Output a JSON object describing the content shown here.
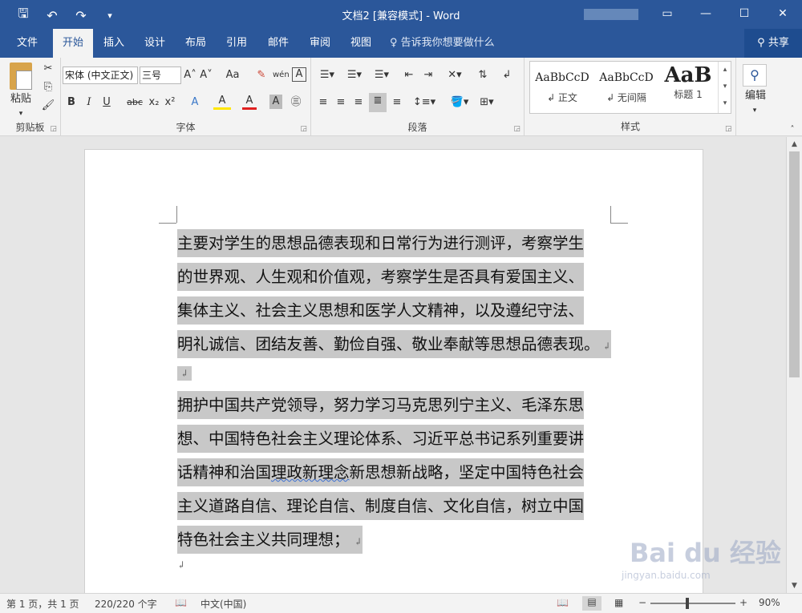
{
  "app": {
    "title": "文档2 [兼容模式] - Word",
    "window_buttons": [
      "▭",
      "—",
      "☐",
      "✕"
    ]
  },
  "qat": {
    "save": "🖫",
    "undo": "↶",
    "redo": "↷",
    "more": "▾"
  },
  "tabs": [
    {
      "label": "文件"
    },
    {
      "label": "开始"
    },
    {
      "label": "插入"
    },
    {
      "label": "设计"
    },
    {
      "label": "布局"
    },
    {
      "label": "引用"
    },
    {
      "label": "邮件"
    },
    {
      "label": "审阅"
    },
    {
      "label": "视图"
    }
  ],
  "tell_me": "♀ 告诉我你想要做什么",
  "share": "共享",
  "ribbon": {
    "clipboard": {
      "label": "剪贴板",
      "paste": "粘贴"
    },
    "font": {
      "label": "字体",
      "font_name": "宋体 (中文正文)",
      "font_size": "三号",
      "buttons": [
        "B",
        "I",
        "U",
        "abc",
        "x₂",
        "x²",
        "A",
        "A",
        "A",
        "A"
      ],
      "top_buttons": [
        "A˄",
        "A˅",
        "Aa",
        "✎",
        "wén",
        "A"
      ]
    },
    "paragraph": {
      "label": "段落"
    },
    "styles": {
      "label": "样式",
      "items": [
        {
          "preview": "AaBbCcD",
          "name": "↲ 正文"
        },
        {
          "preview": "AaBbCcD",
          "name": "↲ 无间隔"
        },
        {
          "preview": "AaB",
          "name": "标题 1"
        }
      ]
    },
    "editing": {
      "label": "编辑"
    }
  },
  "document": {
    "para1": [
      "主要对学生的思想品德表现和日常行为进行测评，考察学生",
      "的世界观、人生观和价值观，考察学生是否具有爱国主义、",
      "集体主义、社会主义思想和医学人文精神，以及遵纪守法、",
      "明礼诚信、团结友善、勤俭自强、敬业奉献等思想品德表现。"
    ],
    "para2": [
      "拥护中国共产党领导，努力学习马克思列宁主义、毛泽东思",
      "想、中国特色社会主义理论体系、习近平总书记系列重要讲"
    ],
    "para2_line3_a": "话精神和治国",
    "para2_line3_b": "理政新理念",
    "para2_line3_c": "新思想新战略，坚定中国特色社会",
    "para2_rest": [
      "主义道路自信、理论自信、制度自信、文化自信，树立中国",
      "特色社会主义共同理想；"
    ],
    "para_mark": "↲"
  },
  "status": {
    "page": "第 1 页，共 1 页",
    "words": "220/220 个字",
    "lang": "中文(中国)",
    "zoom_minus": "−",
    "zoom_plus": "+",
    "zoom": "90%",
    "zoom_level": 0.9
  },
  "watermark": {
    "main": "Bai du 经验",
    "sub": "jingyan.baidu.com"
  }
}
